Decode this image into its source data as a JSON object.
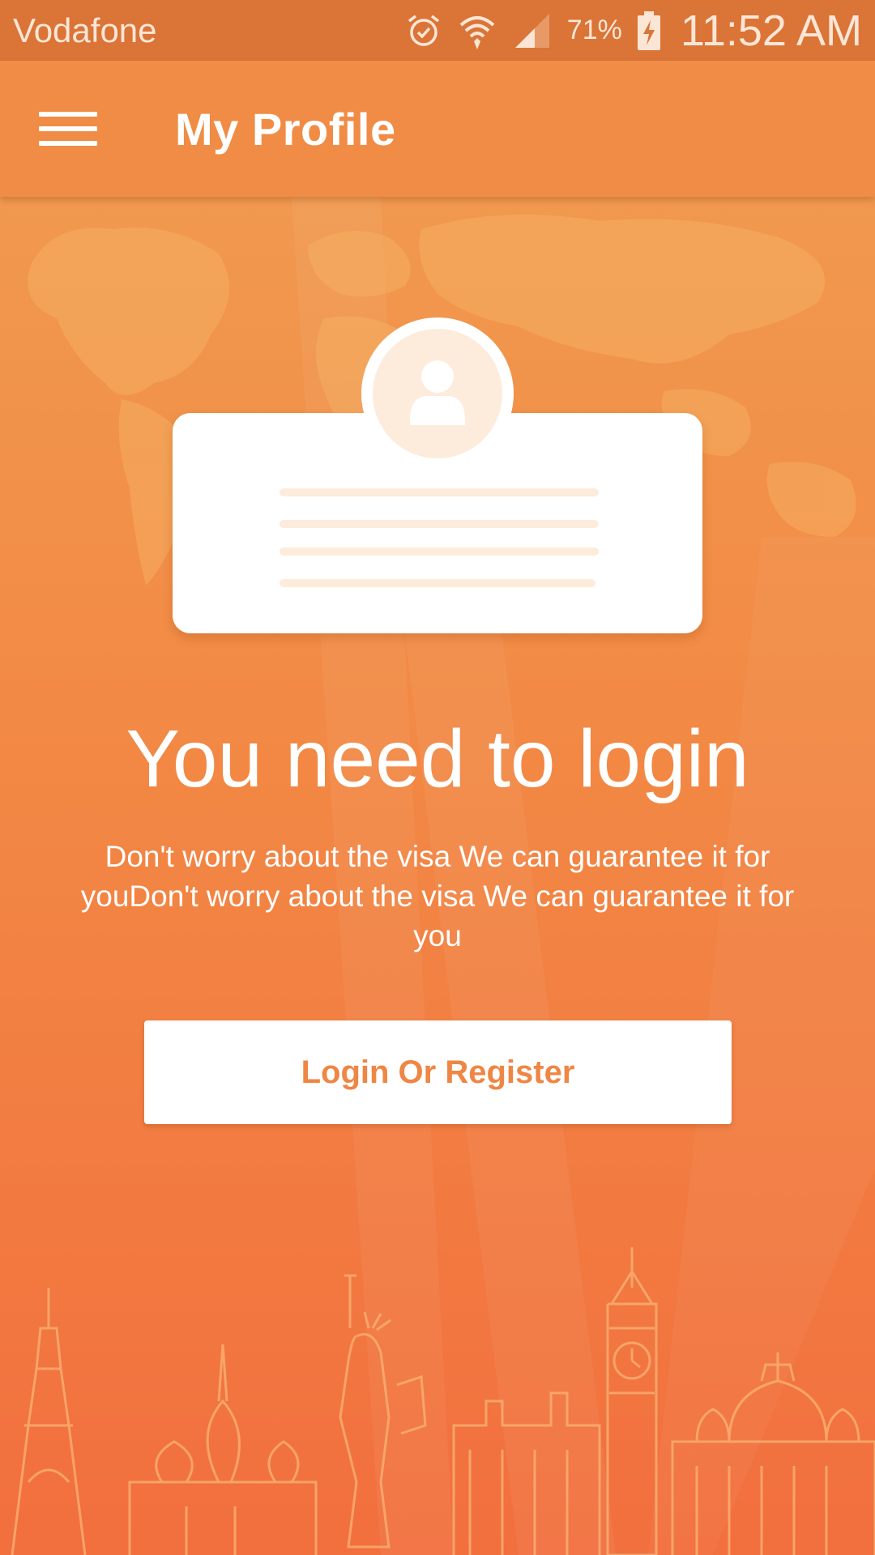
{
  "status_bar": {
    "carrier": "Vodafone",
    "battery_percent": "71%",
    "time": "11:52 AM",
    "icons": [
      "alarm-icon",
      "wifi-icon",
      "signal-icon",
      "battery-charging-icon"
    ]
  },
  "app_bar": {
    "title": "My Profile",
    "menu_icon": "hamburger-menu-icon"
  },
  "main": {
    "headline": "You need to login",
    "description": "Don't worry about the visa We can guarantee it for youDon't worry about the visa We can guarantee it for you",
    "login_button": "Login Or Register"
  },
  "colors": {
    "status_bar": "#db7437",
    "app_bar": "#f08c45",
    "background_top": "#f09f52",
    "background_bottom": "#f26f3e",
    "button_text": "#ef8643"
  }
}
